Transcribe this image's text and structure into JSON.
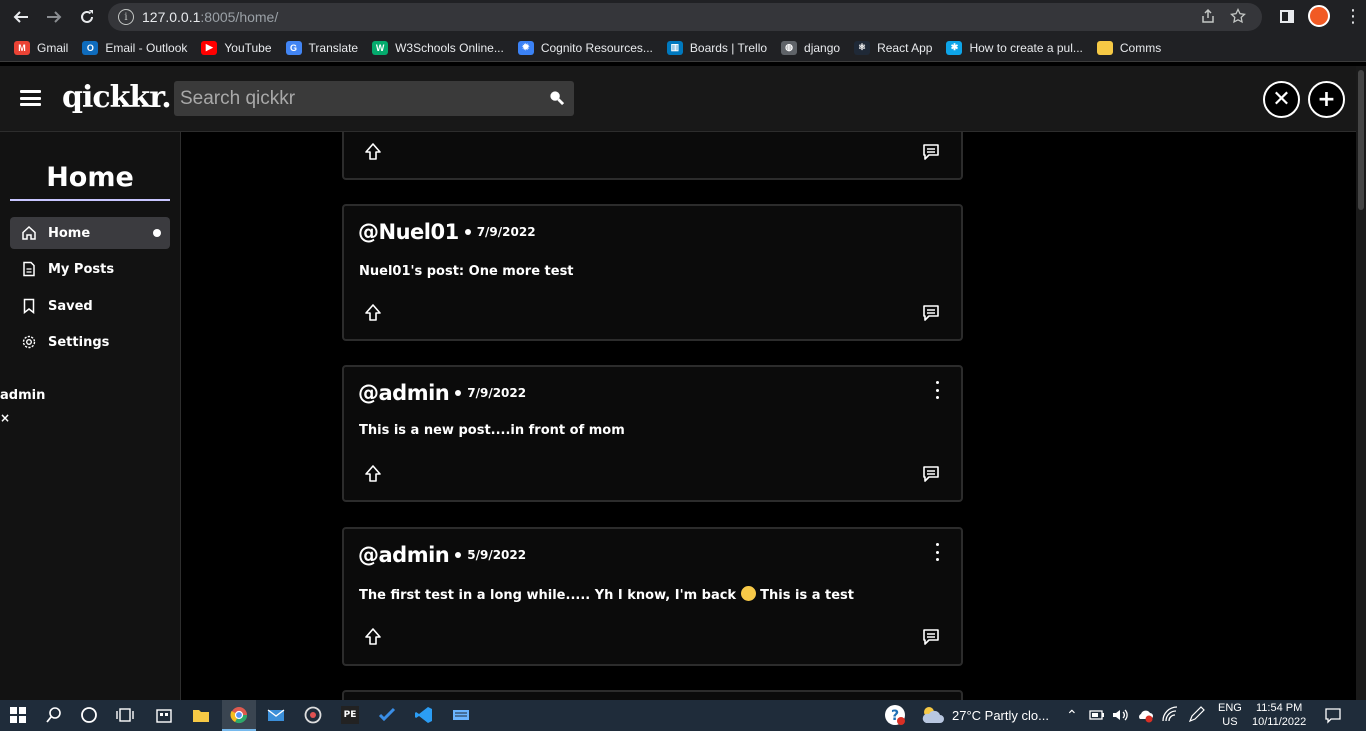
{
  "browser": {
    "url_host": "127.0.0.1",
    "url_rest": ":8005/home/",
    "bookmarks": [
      {
        "label": "Gmail",
        "icon": "gmail-icon",
        "color": "#ea4335",
        "glyph": "M"
      },
      {
        "label": "Email - Outlook",
        "icon": "outlook-icon",
        "color": "#0f6cbd",
        "glyph": "O"
      },
      {
        "label": "YouTube",
        "icon": "youtube-icon",
        "color": "#ff0000",
        "glyph": "▶"
      },
      {
        "label": "Translate",
        "icon": "translate-icon",
        "color": "#4285f4",
        "glyph": "G"
      },
      {
        "label": "W3Schools Online...",
        "icon": "w3schools-icon",
        "color": "#04aa6d",
        "glyph": "W"
      },
      {
        "label": "Cognito Resources...",
        "icon": "cognito-icon",
        "color": "#3b82f6",
        "glyph": "✹"
      },
      {
        "label": "Boards | Trello",
        "icon": "trello-icon",
        "color": "#0079bf",
        "glyph": "▥"
      },
      {
        "label": "django",
        "icon": "globe-icon",
        "color": "#5f6368",
        "glyph": "◍"
      },
      {
        "label": "React App",
        "icon": "react-icon",
        "color": "#1f2937",
        "glyph": "⚛"
      },
      {
        "label": "How to create a pul...",
        "icon": "tutorial-icon",
        "color": "#0ea5e9",
        "glyph": "✱"
      },
      {
        "label": "Comms",
        "icon": "folder-icon",
        "color": "#f6c945",
        "glyph": ""
      }
    ]
  },
  "header": {
    "logo": "qickkr.",
    "search_placeholder": "Search qickkr",
    "close_label": "✕",
    "add_label": "+"
  },
  "sidebar": {
    "title": "Home",
    "items": [
      {
        "label": "Home",
        "icon": "home-icon"
      },
      {
        "label": "My Posts",
        "icon": "document-icon"
      },
      {
        "label": "Saved",
        "icon": "bookmark-icon"
      },
      {
        "label": "Settings",
        "icon": "gear-icon"
      }
    ],
    "username": "admin",
    "logout": "×"
  },
  "posts": [
    {
      "author": "",
      "date": "",
      "body": ""
    },
    {
      "author": "@Nuel01",
      "date": "7/9/2022",
      "body": "Nuel01's post: One more test"
    },
    {
      "author": "@admin",
      "date": "7/9/2022",
      "body": "This is a new post....in front of mom"
    },
    {
      "author": "@admin",
      "date": "5/9/2022",
      "body_before": "The first test in a long while..... Yh I know, I'm back",
      "body_after": " This is a test"
    }
  ],
  "taskbar": {
    "weather": "27°C  Partly clo...",
    "lang_top": "ENG",
    "lang_bottom": "US",
    "time": "11:54 PM",
    "date": "10/11/2022"
  },
  "colors": {
    "accent_underline": "#c8c6ff",
    "card_border": "#2c2c2c",
    "taskbar": "#1f2c3a"
  }
}
